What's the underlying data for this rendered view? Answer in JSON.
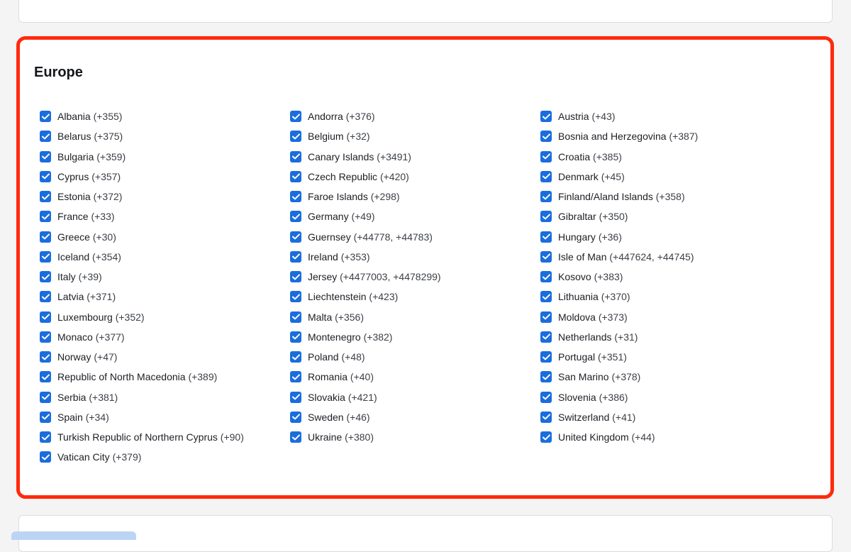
{
  "region": {
    "title": "Europe",
    "accent_border_color": "#ff2a0d",
    "checkbox_color": "#1a6ddd",
    "columns": [
      [
        {
          "name": "Albania",
          "code": "(+355)",
          "checked": true
        },
        {
          "name": "Belarus",
          "code": "(+375)",
          "checked": true
        },
        {
          "name": "Bulgaria",
          "code": "(+359)",
          "checked": true
        },
        {
          "name": "Cyprus",
          "code": "(+357)",
          "checked": true
        },
        {
          "name": "Estonia",
          "code": "(+372)",
          "checked": true
        },
        {
          "name": "France",
          "code": "(+33)",
          "checked": true
        },
        {
          "name": "Greece",
          "code": "(+30)",
          "checked": true
        },
        {
          "name": "Iceland",
          "code": "(+354)",
          "checked": true
        },
        {
          "name": "Italy",
          "code": "(+39)",
          "checked": true
        },
        {
          "name": "Latvia",
          "code": "(+371)",
          "checked": true
        },
        {
          "name": "Luxembourg",
          "code": "(+352)",
          "checked": true
        },
        {
          "name": "Monaco",
          "code": "(+377)",
          "checked": true
        },
        {
          "name": "Norway",
          "code": "(+47)",
          "checked": true
        },
        {
          "name": "Republic of North Macedonia",
          "code": "(+389)",
          "checked": true
        },
        {
          "name": "Serbia",
          "code": "(+381)",
          "checked": true
        },
        {
          "name": "Spain",
          "code": "(+34)",
          "checked": true
        },
        {
          "name": "Turkish Republic of Northern Cyprus",
          "code": "(+90)",
          "checked": true
        },
        {
          "name": "Vatican City",
          "code": "(+379)",
          "checked": true
        }
      ],
      [
        {
          "name": "Andorra",
          "code": "(+376)",
          "checked": true
        },
        {
          "name": "Belgium",
          "code": "(+32)",
          "checked": true
        },
        {
          "name": "Canary Islands",
          "code": "(+3491)",
          "checked": true
        },
        {
          "name": "Czech Republic",
          "code": "(+420)",
          "checked": true
        },
        {
          "name": "Faroe Islands",
          "code": "(+298)",
          "checked": true
        },
        {
          "name": "Germany",
          "code": "(+49)",
          "checked": true
        },
        {
          "name": "Guernsey",
          "code": "(+44778, +44783)",
          "checked": true
        },
        {
          "name": "Ireland",
          "code": "(+353)",
          "checked": true
        },
        {
          "name": "Jersey",
          "code": "(+4477003, +4478299)",
          "checked": true
        },
        {
          "name": "Liechtenstein",
          "code": "(+423)",
          "checked": true
        },
        {
          "name": "Malta",
          "code": "(+356)",
          "checked": true
        },
        {
          "name": "Montenegro",
          "code": "(+382)",
          "checked": true
        },
        {
          "name": "Poland",
          "code": "(+48)",
          "checked": true
        },
        {
          "name": "Romania",
          "code": "(+40)",
          "checked": true
        },
        {
          "name": "Slovakia",
          "code": "(+421)",
          "checked": true
        },
        {
          "name": "Sweden",
          "code": "(+46)",
          "checked": true
        },
        {
          "name": "Ukraine",
          "code": "(+380)",
          "checked": true
        }
      ],
      [
        {
          "name": "Austria",
          "code": "(+43)",
          "checked": true
        },
        {
          "name": "Bosnia and Herzegovina",
          "code": "(+387)",
          "checked": true
        },
        {
          "name": "Croatia",
          "code": "(+385)",
          "checked": true
        },
        {
          "name": "Denmark",
          "code": "(+45)",
          "checked": true
        },
        {
          "name": "Finland/Aland Islands",
          "code": "(+358)",
          "checked": true
        },
        {
          "name": "Gibraltar",
          "code": "(+350)",
          "checked": true
        },
        {
          "name": "Hungary",
          "code": "(+36)",
          "checked": true
        },
        {
          "name": "Isle of Man",
          "code": "(+447624, +44745)",
          "checked": true
        },
        {
          "name": "Kosovo",
          "code": "(+383)",
          "checked": true
        },
        {
          "name": "Lithuania",
          "code": "(+370)",
          "checked": true
        },
        {
          "name": "Moldova",
          "code": "(+373)",
          "checked": true
        },
        {
          "name": "Netherlands",
          "code": "(+31)",
          "checked": true
        },
        {
          "name": "Portugal",
          "code": "(+351)",
          "checked": true
        },
        {
          "name": "San Marino",
          "code": "(+378)",
          "checked": true
        },
        {
          "name": "Slovenia",
          "code": "(+386)",
          "checked": true
        },
        {
          "name": "Switzerland",
          "code": "(+41)",
          "checked": true
        },
        {
          "name": "United Kingdom",
          "code": "(+44)",
          "checked": true
        }
      ]
    ]
  }
}
